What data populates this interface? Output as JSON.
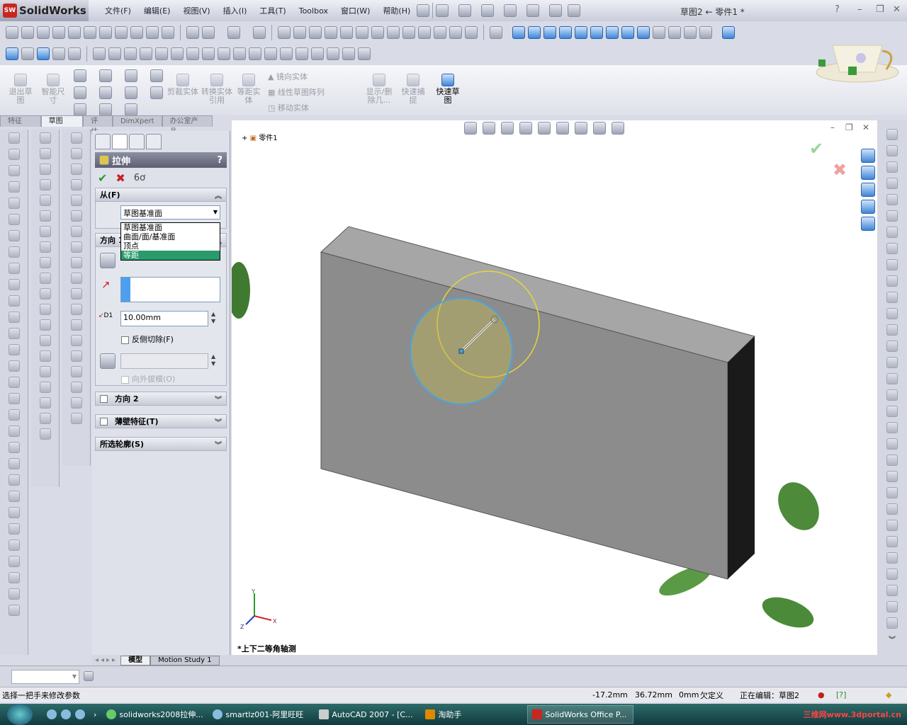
{
  "app": {
    "logo": "SolidWorks",
    "document_title": "草图2 ← 零件1 *"
  },
  "menu": [
    "文件(F)",
    "编辑(E)",
    "视图(V)",
    "插入(I)",
    "工具(T)",
    "Toolbox",
    "窗口(W)",
    "帮助(H)"
  ],
  "command_manager": {
    "items": [
      "退出草图",
      "智能尺寸",
      "剪裁实体",
      "转换实体引用",
      "等距实体",
      "显示/删除几...",
      "快速捕捉",
      "快速草图"
    ],
    "list_items": [
      "镜向实体",
      "线性草图阵列",
      "移动实体"
    ],
    "tabs": [
      "特征",
      "草图",
      "评估",
      "DimXpert",
      "办公室产品"
    ],
    "active_tab": "草图"
  },
  "tree": {
    "root": "零件1"
  },
  "property_manager": {
    "title": "拉伸",
    "help": "?",
    "from_group": "从(F)",
    "from_value": "草图基准面",
    "from_options": [
      "草图基准面",
      "曲面/面/基准面",
      "顶点",
      "等距"
    ],
    "from_selected": "等距",
    "direction1": "方向 1",
    "depth": "10.00mm",
    "depth_icon_label": "D1",
    "reverse_cut": "反侧切除(F)",
    "draft_outward": "向外拔模(O)",
    "direction2": "方向 2",
    "thin_feature": "薄壁特征(T)",
    "selected_contours": "所选轮廓(S)"
  },
  "viewport": {
    "view_label": "*上下二等角轴测",
    "axis_labels": [
      "Y",
      "X",
      "Z"
    ]
  },
  "model_tabs": [
    "模型",
    "Motion Study 1"
  ],
  "status": {
    "message": "选择一把手来修改参数",
    "x": "-17.2mm",
    "y": "36.72mm",
    "z": "0mm",
    "state": "欠定义",
    "editing": "正在编辑：草图2"
  },
  "taskbar": {
    "items": [
      "solidworks2008拉伸...",
      "smartlz001-阿里旺旺",
      "AutoCAD 2007 - [C...",
      "淘助手",
      "SolidWorks Office P..."
    ],
    "active": "SolidWorks Office P...",
    "watermark": "三维网www.3dportal.cn"
  },
  "colors": {
    "accent_selection": "#2a9a6a",
    "body_face": "#8c8c8c",
    "sketch_circle": "#e6d83a",
    "selected_circle": "#4aa3e0"
  }
}
